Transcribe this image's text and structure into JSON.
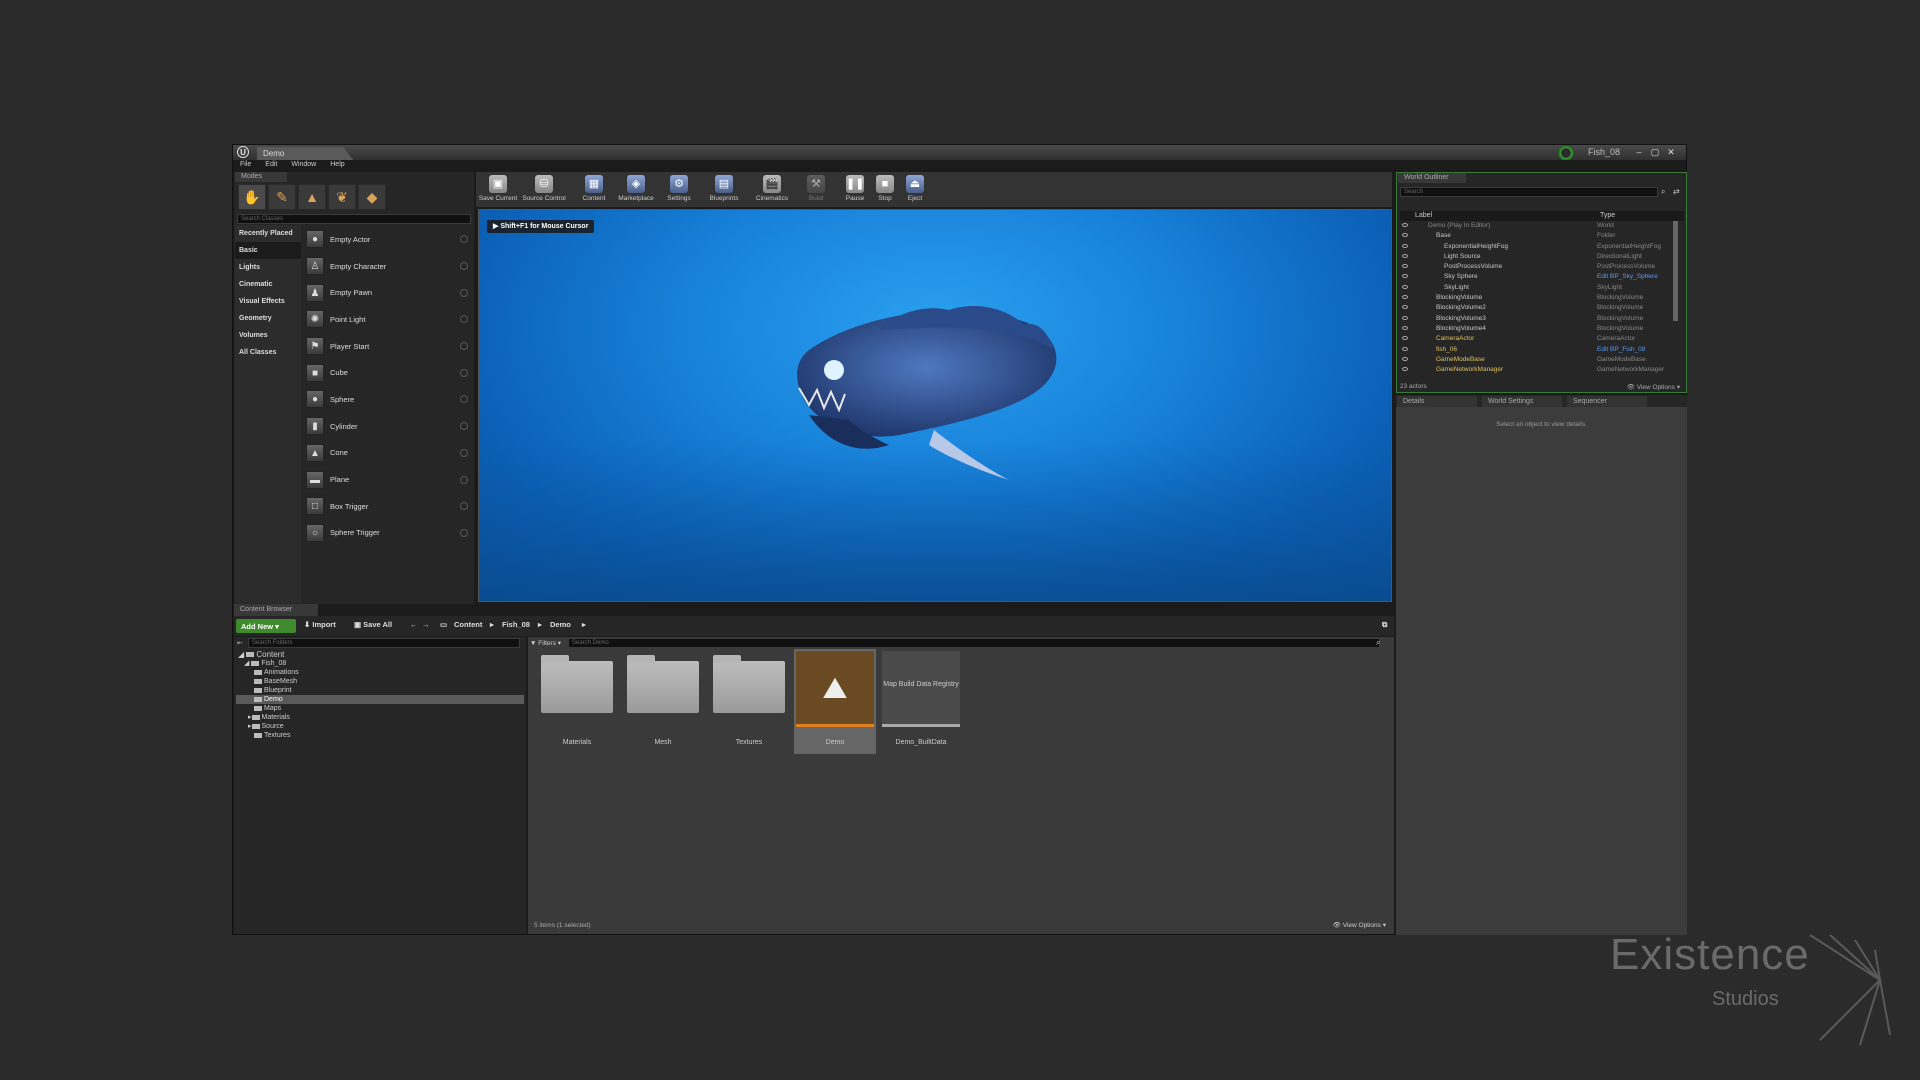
{
  "window": {
    "tab_title": "Demo",
    "project_name": "Fish_08",
    "minimize": "–",
    "maximize": "▢",
    "close": "✕"
  },
  "menu": [
    "File",
    "Edit",
    "Window",
    "Help"
  ],
  "modes": {
    "tab_label": "Modes",
    "search_placeholder": "Search Classes",
    "categories": [
      "Recently Placed",
      "Basic",
      "Lights",
      "Cinematic",
      "Visual Effects",
      "Geometry",
      "Volumes",
      "All Classes"
    ],
    "selected_category": "Basic",
    "items": [
      "Empty Actor",
      "Empty Character",
      "Empty Pawn",
      "Point Light",
      "Player Start",
      "Cube",
      "Sphere",
      "Cylinder",
      "Cone",
      "Plane",
      "Box Trigger",
      "Sphere Trigger"
    ]
  },
  "toolbar": {
    "buttons": [
      "Save Current",
      "Source Control",
      "Content",
      "Marketplace",
      "Settings",
      "Blueprints",
      "Cinematics",
      "Build",
      "Pause",
      "Stop",
      "Eject"
    ]
  },
  "viewport": {
    "hint": "Shift+F1 for Mouse Cursor"
  },
  "outliner": {
    "tab_label": "World Outliner",
    "search_placeholder": "Search",
    "col_label": "Label",
    "col_type": "Type",
    "rows": [
      {
        "label": "Demo (Play In Editor)",
        "type": "World"
      },
      {
        "label": "Base",
        "type": "Folder"
      },
      {
        "label": "ExponentialHeightFog",
        "type": "ExponentialHeightFog"
      },
      {
        "label": "Light Source",
        "type": "DirectionalLight"
      },
      {
        "label": "PostProcessVolume",
        "type": "PostProcessVolume"
      },
      {
        "label": "Sky Sphere",
        "type": "Edit BP_Sky_Sphere"
      },
      {
        "label": "SkyLight",
        "type": "SkyLight"
      },
      {
        "label": "BlockingVolume",
        "type": "BlockingVolume"
      },
      {
        "label": "BlockingVolume2",
        "type": "BlockingVolume"
      },
      {
        "label": "BlockingVolume3",
        "type": "BlockingVolume"
      },
      {
        "label": "BlockingVolume4",
        "type": "BlockingVolume"
      },
      {
        "label": "CameraActor",
        "type": "CameraActor"
      },
      {
        "label": "fish_06",
        "type": "Edit BP_Fish_08"
      },
      {
        "label": "GameModeBase",
        "type": "GameModeBase"
      },
      {
        "label": "GameNetworkManager",
        "type": "GameNetworkManager"
      }
    ],
    "count": "23 actors",
    "view_options": "View Options"
  },
  "details": {
    "tabs": [
      "Details",
      "World Settings",
      "Sequencer"
    ],
    "message": "Select an object to view details."
  },
  "content_browser": {
    "tab_label": "Content Browser",
    "add_new": "Add New",
    "import": "Import",
    "save_all": "Save All",
    "breadcrumb": [
      "Content",
      "Fish_08",
      "Demo"
    ],
    "folder_search_placeholder": "Search Folders",
    "asset_search_placeholder": "Search Demo",
    "filters": "Filters",
    "tree": [
      "Content",
      "Fish_08",
      "Animations",
      "BaseMesh",
      "Blueprint",
      "Demo",
      "Maps",
      "Materials",
      "Source",
      "Textures"
    ],
    "assets": [
      "Materials",
      "Mesh",
      "Textures",
      "Demo",
      "Demo_BuiltData"
    ],
    "builtdata_thumb": "Map Build Data Registry",
    "status": "5 items (1 selected)",
    "view_options": "View Options"
  },
  "watermark": {
    "line1": "Existence",
    "line2": "Studios"
  }
}
